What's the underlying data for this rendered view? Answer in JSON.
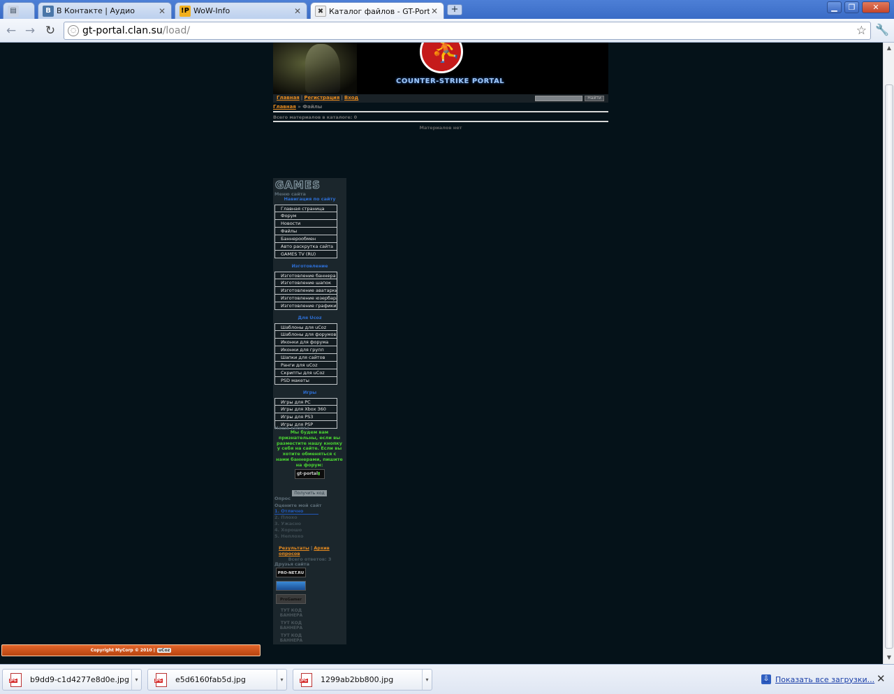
{
  "browser": {
    "tabs": [
      {
        "title": "",
        "favicon": ""
      },
      {
        "title": "В Контакте | Аудио",
        "favicon": "B"
      },
      {
        "title": "WoW-Info",
        "favicon": "!P"
      },
      {
        "title": "Каталог файлов - GT-Portal",
        "favicon": ""
      }
    ],
    "new_tab": "+",
    "url_host": "gt-portal.clan.su",
    "url_path": "/load/"
  },
  "site": {
    "header_logo_text": "COUNTER-STRIKE PORTAL",
    "top_menu": [
      "Главная",
      "Регистрация",
      "Вход"
    ],
    "search_button": "Найти",
    "breadcrumb_home": "Главная",
    "breadcrumb_sep": "»",
    "breadcrumb_current": "Файлы",
    "total_materials": "Всего материалов в каталоге: 0",
    "no_materials": "Материалов нет",
    "games_logo": "GAMES",
    "menu_block_title": "Меню сайта",
    "sections": [
      {
        "title": "Навигация по сайту",
        "items": [
          "Главная страница",
          "Форум",
          "Новости",
          "Файлы",
          "Баннерообмен",
          "Авто раскрутка сайта",
          "GAMES TV (RU)"
        ]
      },
      {
        "title": "Изготовление",
        "items": [
          "Изготовление баннера",
          "Изготовление шапок",
          "Изготовление аватарки",
          "Изготовление юзербара",
          "Изготовление графики"
        ]
      },
      {
        "title": "Для Ucoz",
        "items": [
          "Шаблоны для uCoz",
          "Шаблоны для форумов",
          "Иконки для форума",
          "Иконки для групп",
          "Шапки для сайтов",
          "Ранги для uCoz",
          "Скрипты для uCoz",
          "PSD макеты"
        ]
      },
      {
        "title": "Игры",
        "items": [
          "Игры для PC",
          "Игры для Xbox 360",
          "Игры для PS3",
          "Игры для PSP"
        ]
      }
    ],
    "our_button_title": "Наша кнопка",
    "our_button_text": "Мы будем вам признательны, если вы разместите нашу кнопку у себя на сайте. Если вы хотите обменяться с нами баннерами, пишите на форум:",
    "our_button_banner": "gt-portal",
    "get_code": "Получить код",
    "poll_title": "Опрос",
    "poll_question": "Оцените мой сайт",
    "poll_options": [
      "1. Отлично",
      "2. Плохо",
      "3. Ужасно",
      "4. Хорошо",
      "5. Неплохо"
    ],
    "poll_results": "Результаты",
    "poll_archive": "Архив опросов",
    "poll_total": "Всего ответов: 3",
    "friends_title": "Друзья сайта",
    "friend_banners": [
      "PRO-NET.RU",
      "",
      "ProGamer"
    ],
    "code_placeholders": [
      "ТУТ КОД БАННЕРА",
      "ТУТ КОД БАННЕРА",
      "ТУТ КОД БАННЕРА"
    ],
    "copyright": "Copyright MyCorp © 2010 |",
    "ucoz_badge": "uCoz"
  },
  "downloads": {
    "files": [
      "b9dd9-c1d4277e8d0e.jpg",
      "e5d6160fab5d.jpg",
      "1299ab2bb800.jpg"
    ],
    "file_tag": "JPG",
    "show_all": "Показать все загрузки..."
  }
}
